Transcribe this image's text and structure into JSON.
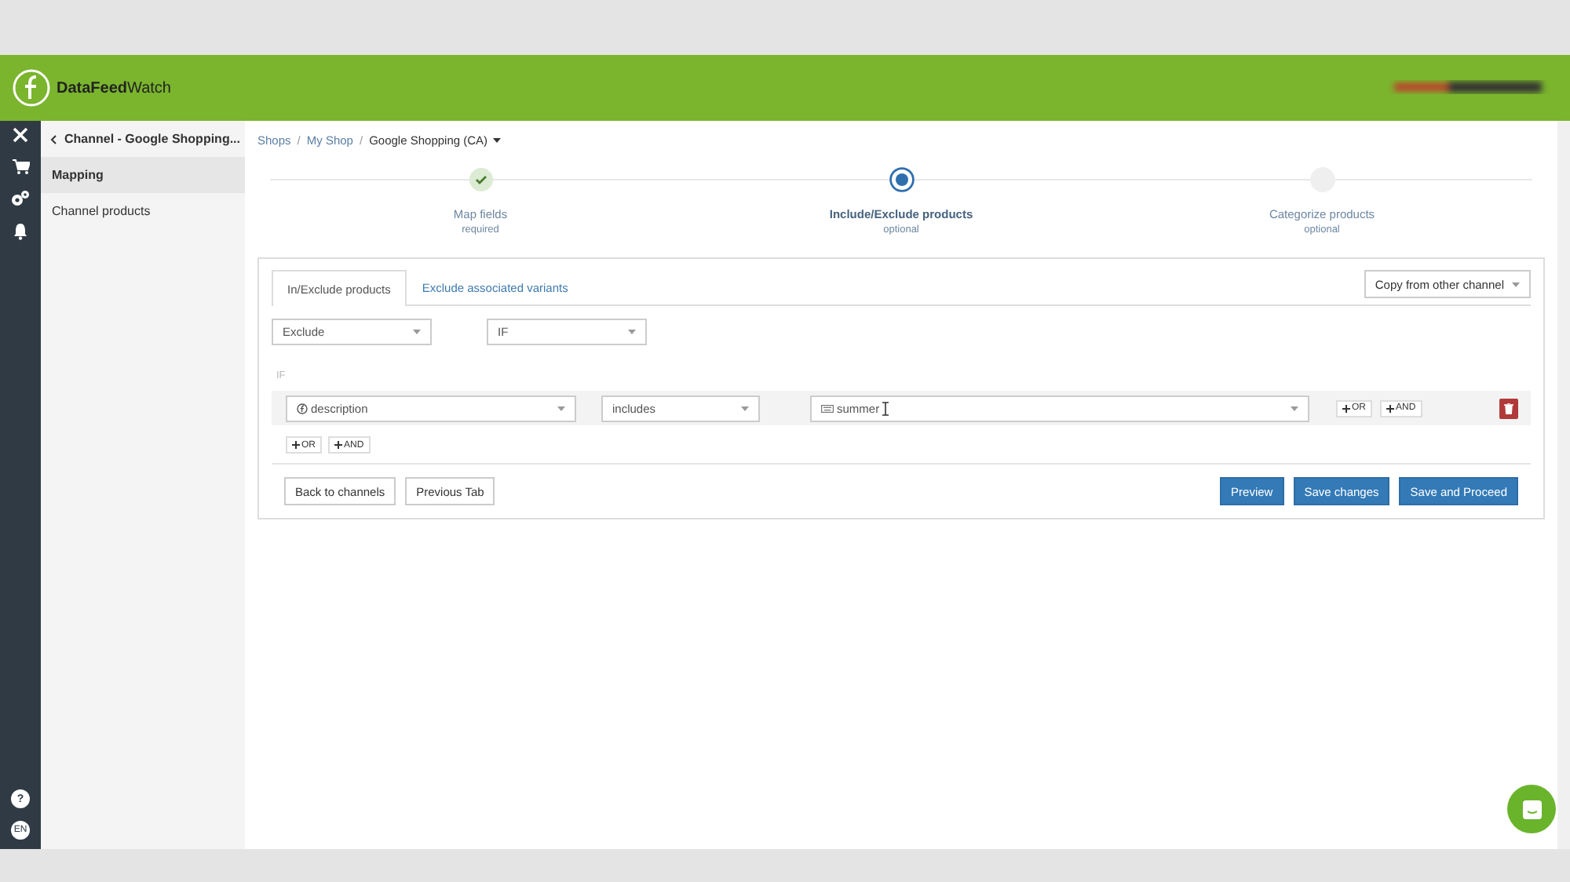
{
  "header": {
    "logo_bold": "DataFeed",
    "logo_light": "Watch"
  },
  "rail": {
    "help": "?",
    "language": "EN"
  },
  "sidebar": {
    "back_title": "Channel - Google Shopping...",
    "items": [
      {
        "label": "Mapping",
        "selected": true
      },
      {
        "label": "Channel products",
        "selected": false
      }
    ]
  },
  "breadcrumb": [
    {
      "label": "Shops",
      "kind": "link",
      "separator": "/"
    },
    {
      "label": "My Shop",
      "kind": "link",
      "separator": "/"
    },
    {
      "label": "Google Shopping (CA)",
      "kind": "dropdown"
    }
  ],
  "steps": [
    {
      "title": "Map fields",
      "subtitle": "required",
      "completed": true,
      "selected": false
    },
    {
      "title": "Include/Exclude products",
      "subtitle": "optional",
      "completed": false,
      "selected": true
    },
    {
      "title": "Categorize products",
      "subtitle": "optional",
      "completed": false,
      "selected": false
    }
  ],
  "tabs": [
    {
      "label": "In/Exclude products",
      "selected": true
    },
    {
      "label": "Exclude associated variants",
      "selected": false
    }
  ],
  "copy_button": "Copy from other channel",
  "action_select": "Exclude",
  "condition_select": "IF",
  "if_label": "IF",
  "rule": {
    "field": "description",
    "operator": "includes",
    "value": "summer",
    "or": "OR",
    "and": "AND"
  },
  "group_or": "OR",
  "group_and": "AND",
  "left_buttons": [
    "Back to channels",
    "Previous Tab"
  ],
  "right_buttons": [
    "Preview",
    "Save changes",
    "Save and Proceed"
  ]
}
